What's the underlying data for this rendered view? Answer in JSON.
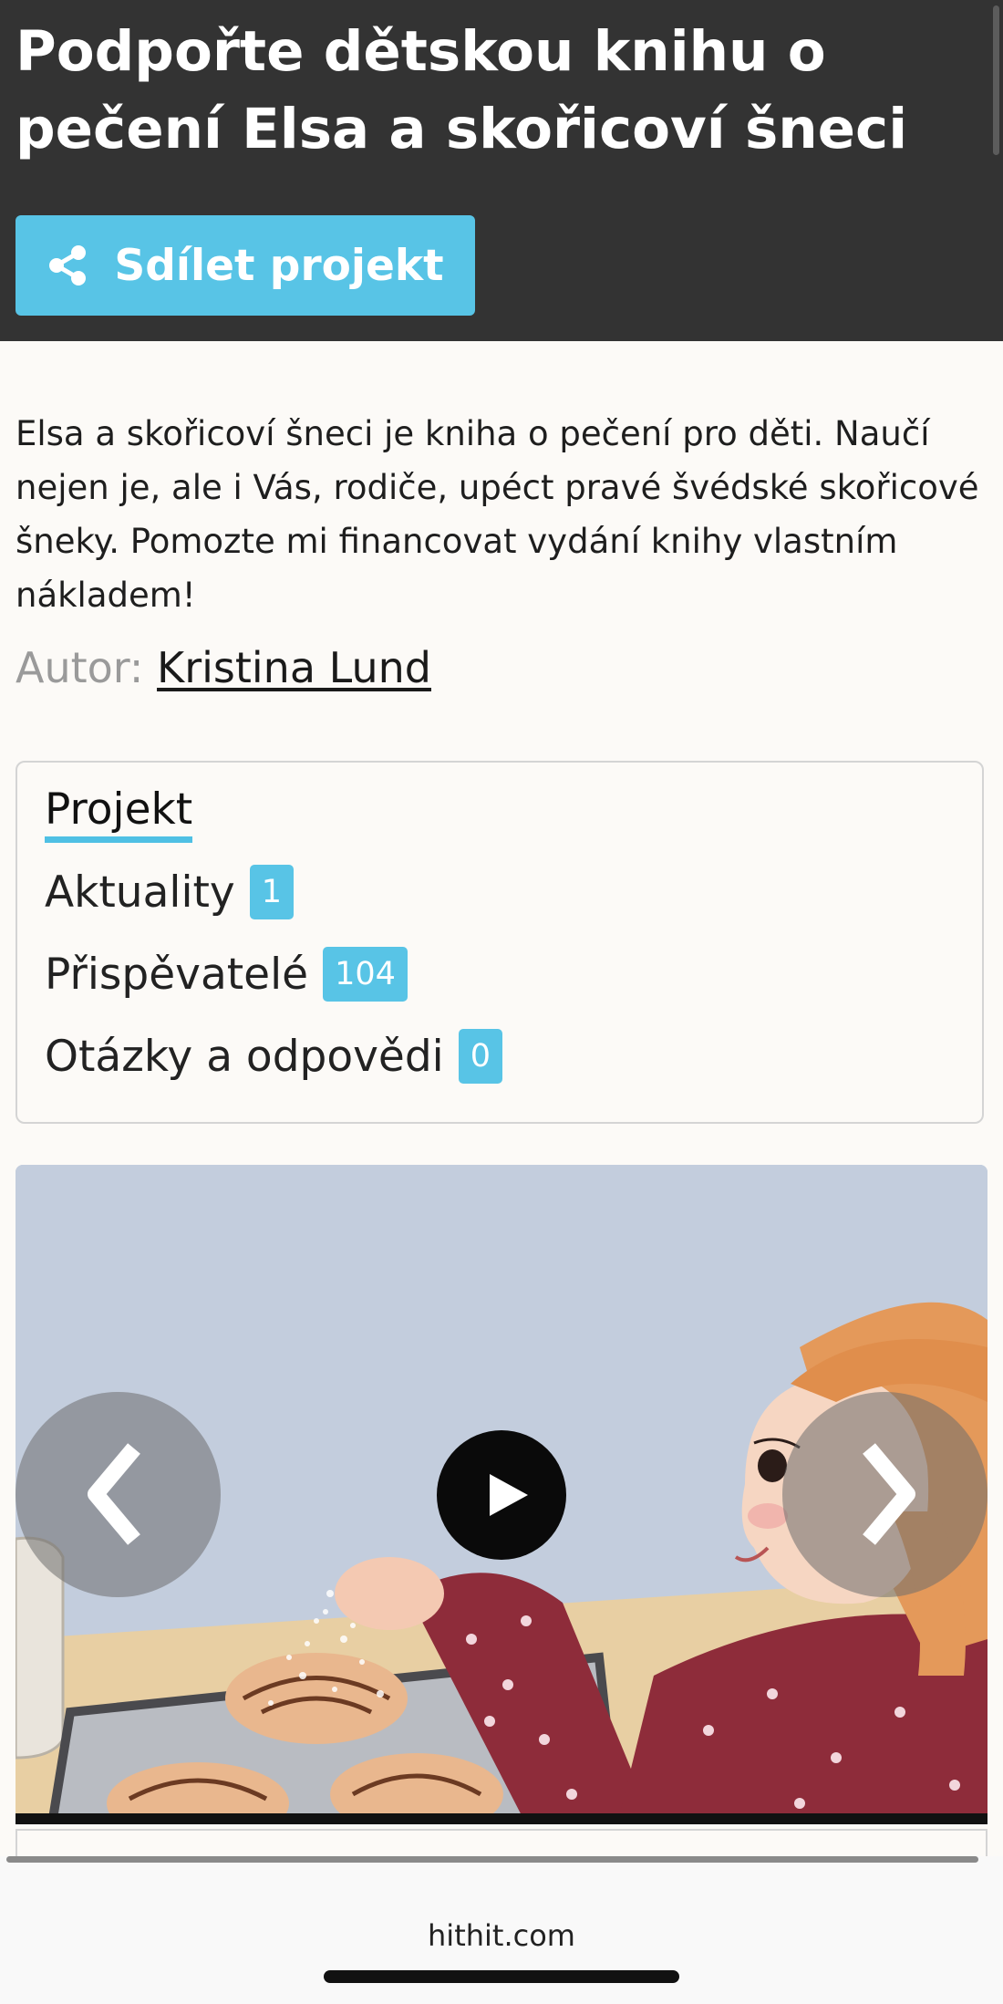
{
  "header": {
    "title": "Podpořte dětskou knihu o pečení Elsa a skořicoví šneci",
    "share_label": "Sdílet projekt",
    "share_icon": "share-icon",
    "background_color": "#333333",
    "accent_color": "#58c4e6"
  },
  "description": "Elsa a skořicoví šneci je kniha o pečení pro děti. Naučí nejen je, ale i Vás, rodiče, upéct pravé švédské skořicové šneky. Pomozte mi financovat vydání knihy vlastním nákladem!",
  "author": {
    "label": "Autor:",
    "name": "Kristina Lund"
  },
  "project_nav": {
    "items": [
      {
        "label": "Projekt",
        "active": true
      },
      {
        "label": "Aktuality",
        "count": "1"
      },
      {
        "label": "Přispěvatelé",
        "count": "104"
      },
      {
        "label": "Otázky a odpovědi",
        "count": "0"
      }
    ]
  },
  "media": {
    "prev_glyph": "❮",
    "next_glyph": "❯",
    "play_icon": "play-icon"
  },
  "browser": {
    "url": "hithit.com",
    "page_progress": 1.0
  }
}
